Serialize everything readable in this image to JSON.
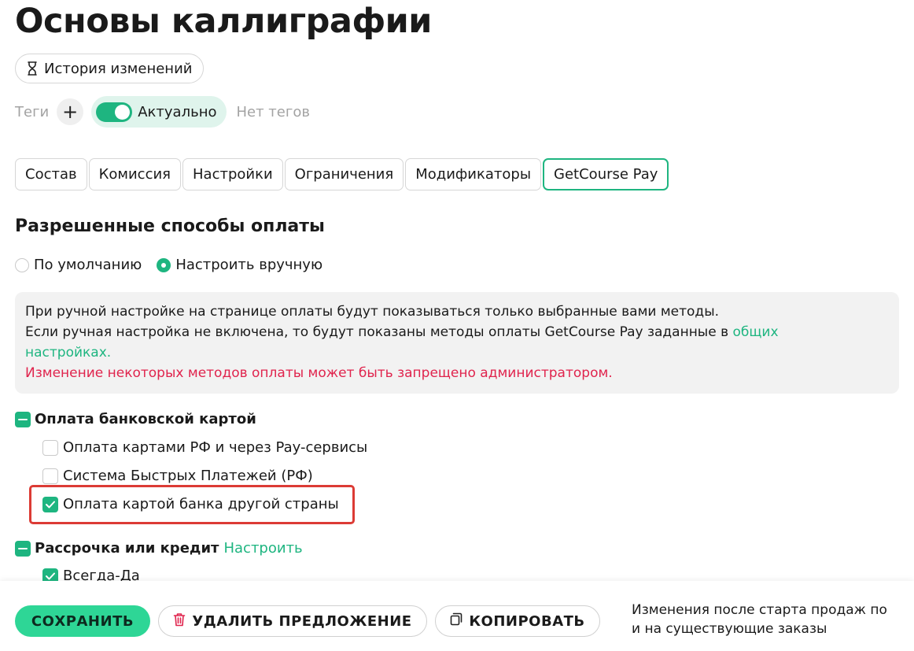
{
  "page": {
    "title": "Основы каллиграфии"
  },
  "history": {
    "label": "История изменений",
    "icon": "hourglass-icon"
  },
  "tags": {
    "label": "Теги",
    "add_symbol": "+",
    "actual_label": "Актуально",
    "actual_enabled": true,
    "empty_text": "Нет тегов"
  },
  "tabs": [
    {
      "label": "Состав",
      "active": false
    },
    {
      "label": "Комиссия",
      "active": false
    },
    {
      "label": "Настройки",
      "active": false
    },
    {
      "label": "Ограничения",
      "active": false
    },
    {
      "label": "Модификаторы",
      "active": false
    },
    {
      "label": "GetCourse Pay",
      "active": true
    }
  ],
  "payment": {
    "section_title": "Разрешенные способы оплаты",
    "mode_options": [
      {
        "label": "По умолчанию",
        "selected": false
      },
      {
        "label": "Настроить вручную",
        "selected": true
      }
    ],
    "info": {
      "line1": "При ручной настройке на странице оплаты будут показываться только выбранные вами методы.",
      "line2_prefix": "Если ручная настройка не включена, то будут показаны методы оплаты GetCourse Pay заданные в ",
      "line2_link": "общих настройках.",
      "warning": "Изменение некоторых методов оплаты может быть запрещено администратором."
    },
    "groups": [
      {
        "label": "Оплата банковской картой",
        "state": "partial",
        "link": "",
        "items": [
          {
            "label": "Оплата картами РФ и через Pay-сервисы",
            "checked": false
          },
          {
            "label": "Система Быстрых Платежей (РФ)",
            "checked": false
          },
          {
            "label": "Оплата картой банка другой страны",
            "checked": true
          }
        ]
      },
      {
        "label": "Рассрочка или кредит",
        "state": "partial",
        "link": "Настроить",
        "items": [
          {
            "label": "Всегда-Да",
            "checked": true
          }
        ]
      }
    ]
  },
  "footer": {
    "save_label": "СОХРАНИТЬ",
    "delete_label": "УДАЛИТЬ ПРЕДЛОЖЕНИЕ",
    "copy_label": "КОПИРОВАТЬ",
    "note_line1": "Изменения после старта продаж по",
    "note_line2": "и на существующие заказы"
  },
  "colors": {
    "accent": "#1eb580",
    "save_button": "#2ed696",
    "warning": "#e0244d",
    "highlight": "#dc3b35",
    "delete_icon": "#e0244d"
  }
}
